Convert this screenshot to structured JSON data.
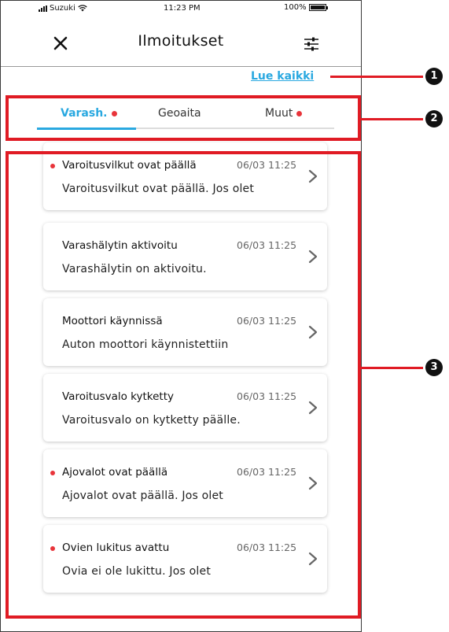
{
  "status_bar": {
    "carrier": "Suzuki",
    "time": "11:23 PM",
    "battery": "100%"
  },
  "header": {
    "title": "Ilmoitukset",
    "close_icon": "close-icon",
    "filter_icon": "sliders-icon"
  },
  "read_all": "Lue kaikki",
  "tabs": [
    {
      "label": "Varash.",
      "active": true,
      "has_dot": true
    },
    {
      "label": "Geoaita",
      "active": false,
      "has_dot": false
    },
    {
      "label": "Muut",
      "active": false,
      "has_dot": true
    }
  ],
  "notifications": [
    {
      "title": "Varoitusvilkut ovat päällä",
      "time": "06/03 11:25",
      "body": "Varoitusvilkut ovat päällä. Jos olet",
      "unread": true
    },
    {
      "title": "Varashälytin aktivoitu",
      "time": "06/03 11:25",
      "body": "Varashälytin on aktivoitu.",
      "unread": false
    },
    {
      "title": "Moottori käynnissä",
      "time": "06/03 11:25",
      "body": "Auton moottori käynnistettiin",
      "unread": false
    },
    {
      "title": "Varoitusvalo kytketty",
      "time": "06/03 11:25",
      "body": "Varoitusvalo on kytketty päälle.",
      "unread": false
    },
    {
      "title": "Ajovalot ovat päällä",
      "time": "06/03 11:25",
      "body": "Ajovalot ovat päällä. Jos olet",
      "unread": true
    },
    {
      "title": "Ovien lukitus avattu",
      "time": "06/03 11:25",
      "body": "Ovia ei ole lukittu. Jos olet",
      "unread": true
    }
  ],
  "annotations": [
    "1",
    "2",
    "3"
  ],
  "colors": {
    "accent": "#29a8e0",
    "unread_dot": "#e8343a",
    "annotation": "#e01b24"
  }
}
